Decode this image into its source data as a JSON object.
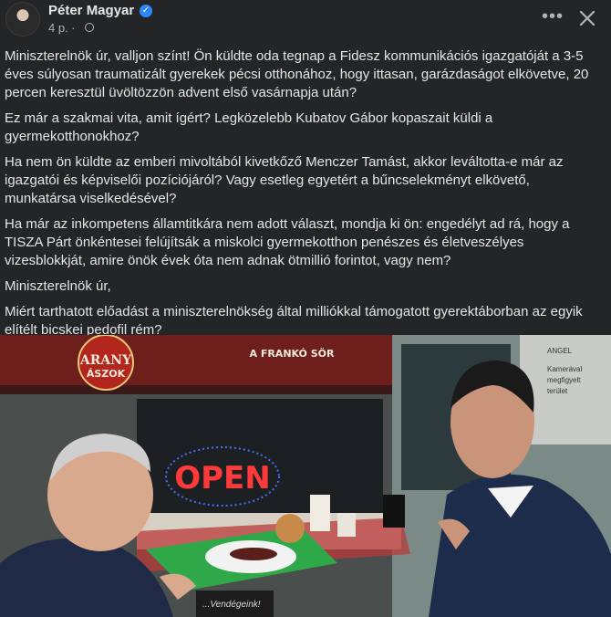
{
  "post": {
    "author": "Péter Magyar",
    "verified_icon": "verified-badge-icon",
    "time": "4 p. ·",
    "privacy_icon": "globe-icon",
    "menu_icon": "more-horizontal-icon",
    "close_icon": "close-icon"
  },
  "paragraphs": [
    "Miniszterelnök úr, valljon színt! Ön küldte oda tegnap a Fidesz kommunikációs igazgatóját a 3-5 éves súlyosan traumatizált gyerekek pécsi otthonához, hogy ittasan, garázdaságot elkövetve, 20 percen keresztül üvöltözzön advent első vasárnapja után?",
    "Ez már a szakmai vita, amit ígért? Legközelebb Kubatov Gábor kopaszait küldi a gyermekotthonokhoz?",
    "Ha nem ön küldte az emberi mivoltából kivetkőző Menczer Tamást, akkor leváltotta-e már az igazgatói és képviselői pozíciójáról? Vagy esetleg egyetért a bűncselekményt elkövető, munkatársa viselkedésével?",
    "Ha már az inkompetens államtitkára nem adott választ, mondja ki ön: engedélyt ad rá, hogy a TISZA Párt önkéntesei felújítsák a miskolci gyermekotthon penészes és életveszélyes vizesblokkját, amire önök évek óta nem adnak ötmillió forintot, vagy nem?",
    "Miniszterelnök úr,",
    "Miért tarthatott előadást a miniszterelnökség által milliókkal támogatott gyerektáborban az egyik elítélt bicskei pedofil rém?"
  ],
  "image": {
    "sign_brand_1": "ARANY",
    "sign_brand_2": "ÁSZOK",
    "sign_slogan": "A FRANKÓ SÖR",
    "neon_sign": "OPEN",
    "right_sign_1": "ANGEL",
    "right_sign_2": "Kamerával",
    "right_sign_3": "megfigyelt",
    "right_sign_4": "terület",
    "bottom_sign": "...Vendégeink!",
    "colors": {
      "background": "#242526",
      "text": "#e4e6eb",
      "muted": "#b0b3b8",
      "verified": "#2d88ff"
    }
  }
}
